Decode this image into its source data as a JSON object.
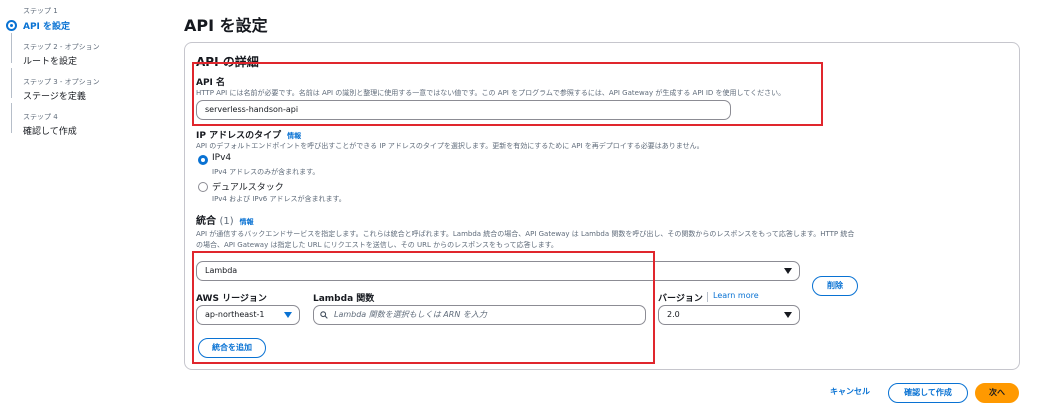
{
  "stepper": {
    "steps": [
      {
        "sub": "ステップ 1",
        "title": "API を設定"
      },
      {
        "sub": "ステップ 2 - オプション",
        "title": "ルートを設定"
      },
      {
        "sub": "ステップ 3 - オプション",
        "title": "ステージを定義"
      },
      {
        "sub": "ステップ 4",
        "title": "確認して作成"
      }
    ]
  },
  "page": {
    "title": "API を設定"
  },
  "details": {
    "heading": "API の詳細",
    "api_name": {
      "label": "API 名",
      "description": "HTTP API には名前が必要です。名前は API の識別と整理に使用する一意ではない値です。この API をプログラムで参照するには、API Gateway が生成する API ID を使用してください。",
      "value": "serverless-handson-api"
    },
    "ip_type": {
      "label": "IP アドレスのタイプ",
      "info": "情報",
      "description": "API のデフォルトエンドポイントを呼び出すことができる IP アドレスのタイプを選択します。更新を有効にするために API を再デプロイする必要はありません。",
      "options": [
        {
          "label": "IPv4",
          "sub": "IPv4 アドレスのみが含まれます。"
        },
        {
          "label": "デュアルスタック",
          "sub": "IPv4 および IPv6 アドレスが含まれます。"
        }
      ]
    },
    "integration": {
      "label": "統合",
      "count": "(1)",
      "info": "情報",
      "description_line1": "API が通信するバックエンドサービスを指定します。これらは統合と呼ばれます。Lambda 統合の場合、API Gateway は Lambda 関数を呼び出し、その関数からのレスポンスをもって応答します。HTTP 統合",
      "description_line2": "の場合、API Gateway は指定した URL にリクエストを送信し、その URL からのレスポンスをもって応答します。",
      "type_value": "Lambda",
      "remove_label": "削除",
      "region_label": "AWS リージョン",
      "region_value": "ap-northeast-1",
      "function_label": "Lambda 関数",
      "function_placeholder": "Lambda 関数を選択もしくは ARN を入力",
      "version_label": "バージョン",
      "learn_more": "Learn more",
      "version_value": "2.0",
      "add_label": "統合を追加"
    }
  },
  "footer": {
    "cancel": "キャンセル",
    "review_create": "確認して作成",
    "next": "次へ"
  },
  "colors": {
    "accent": "#0972d3",
    "primary": "#ff9900",
    "highlight": "#e0262d"
  }
}
